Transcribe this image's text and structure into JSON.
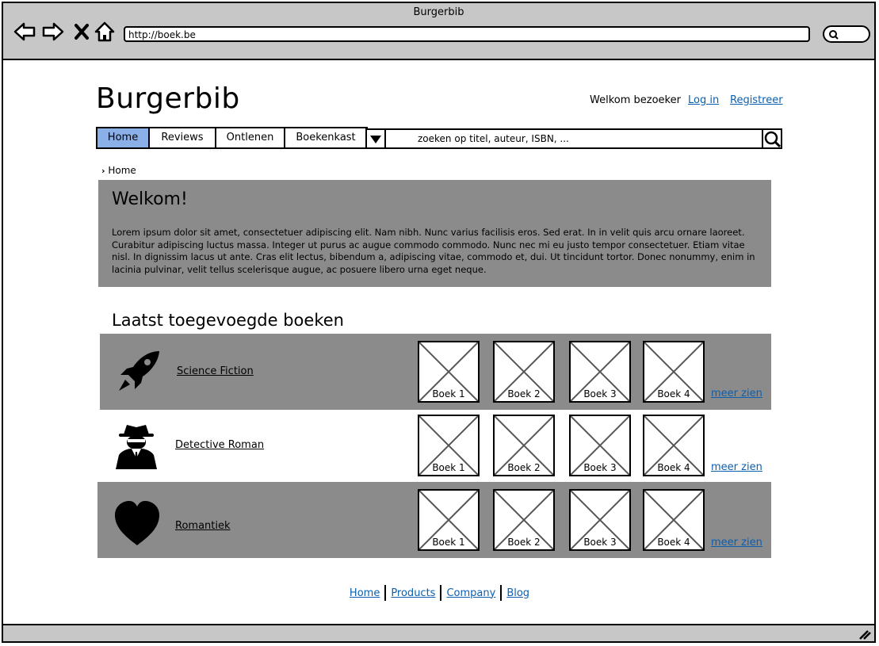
{
  "window": {
    "title": "Burgerbib",
    "url": "http://boek.be"
  },
  "header": {
    "logo": "Burgerbib",
    "welcome": "Welkom bezoeker",
    "login": "Log in",
    "register": "Registreer"
  },
  "nav": {
    "tabs": [
      {
        "label": "Home",
        "active": true
      },
      {
        "label": "Reviews",
        "active": false
      },
      {
        "label": "Ontlenen",
        "active": false
      },
      {
        "label": "Boekenkast",
        "active": false
      }
    ],
    "search_text": "zoeken op titel, auteur, ISBN, ..."
  },
  "breadcrumb": {
    "current": "Home"
  },
  "hero": {
    "title": "Welkom!",
    "body": "Lorem ipsum dolor sit amet, consectetuer adipiscing elit. Nam nibh. Nunc varius facilisis eros. Sed erat. In in velit quis arcu ornare laoreet. Curabitur adipiscing luctus massa. Integer ut purus ac augue commodo commodo. Nunc nec mi eu justo tempor consectetuer. Etiam vitae nisl. In dignissim lacus ut ante. Cras elit lectus, bibendum a, adipiscing vitae, commodo et, dui. Ut tincidunt tortor. Donec nonummy, enim in lacinia pulvinar, velit tellus scelerisque augue, ac posuere libero urna eget neque."
  },
  "latest": {
    "title": "Laatst toegevoegde boeken",
    "more_label": "meer zien",
    "categories": [
      {
        "name": "Science Fiction",
        "icon": "rocket-icon",
        "books": [
          "Boek 1",
          "Boek 2",
          "Boek 3",
          "Boek 4"
        ]
      },
      {
        "name": "Detective Roman",
        "icon": "detective-icon",
        "books": [
          "Boek 1",
          "Boek 2",
          "Boek 3",
          "Boek 4"
        ]
      },
      {
        "name": "Romantiek",
        "icon": "heart-icon",
        "books": [
          "Boek 1",
          "Boek 2",
          "Boek 3",
          "Boek 4"
        ]
      }
    ]
  },
  "footer": {
    "links": [
      "Home",
      "Products",
      "Company",
      "Blog"
    ]
  },
  "colors": {
    "active_tab": "#8bb0e8",
    "panel_gray": "#8b8b8b",
    "chrome_gray": "#c7c7c7",
    "link": "#0b5fb0"
  }
}
